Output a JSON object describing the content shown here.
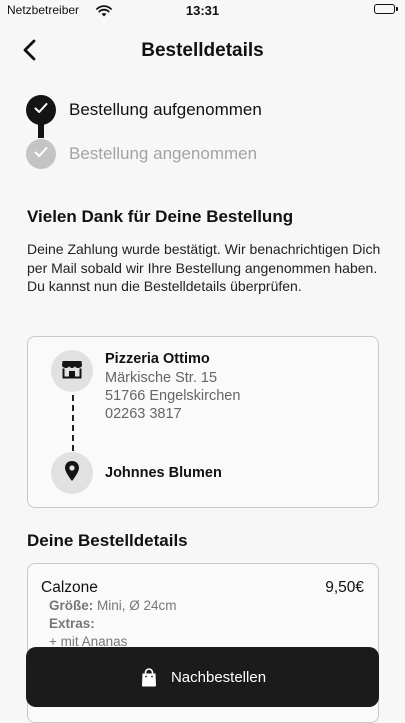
{
  "status_bar": {
    "carrier": "Netzbetreiber",
    "time": "13:31"
  },
  "nav": {
    "title": "Bestelldetails",
    "back_icon": "chevron-left-icon"
  },
  "progress": {
    "steps": [
      {
        "label": "Bestellung aufgenommen",
        "done": true
      },
      {
        "label": "Bestellung angenommen",
        "done": false
      }
    ]
  },
  "confirmation": {
    "heading": "Vielen Dank für Deine Bestellung",
    "text": "Deine Zahlung wurde bestätigt. Wir benachrichtigen Dich per Mail sobald wir Ihre Bestellung angenommen haben. Du kannst nun die Bestelldetails überprüfen."
  },
  "route": {
    "shop": {
      "icon": "store-icon",
      "name": "Pizzeria Ottimo",
      "street": "Märkische Str. 15",
      "city": "51766 Engelskirchen",
      "phone": "02263 3817"
    },
    "destination": {
      "icon": "location-pin-icon",
      "name": "Johnnes Blumen"
    }
  },
  "order_details": {
    "heading": "Deine Bestelldetails",
    "items": [
      {
        "name": "Calzone",
        "price": "9,50€",
        "size_label": "Größe:",
        "size_value": "Mini, Ø 24cm",
        "extras_label": "Extras:",
        "extras": [
          "+ mit Ananas"
        ]
      }
    ]
  },
  "reorder": {
    "label": "Nachbestellen",
    "icon": "shopping-bag-icon"
  },
  "colors": {
    "background": "#f7f7f7",
    "primary_dark": "#1b1b1b",
    "step_pending": "#c4c4c4",
    "card_border": "#c9c9c9",
    "icon_circle": "#e1e1e1"
  }
}
